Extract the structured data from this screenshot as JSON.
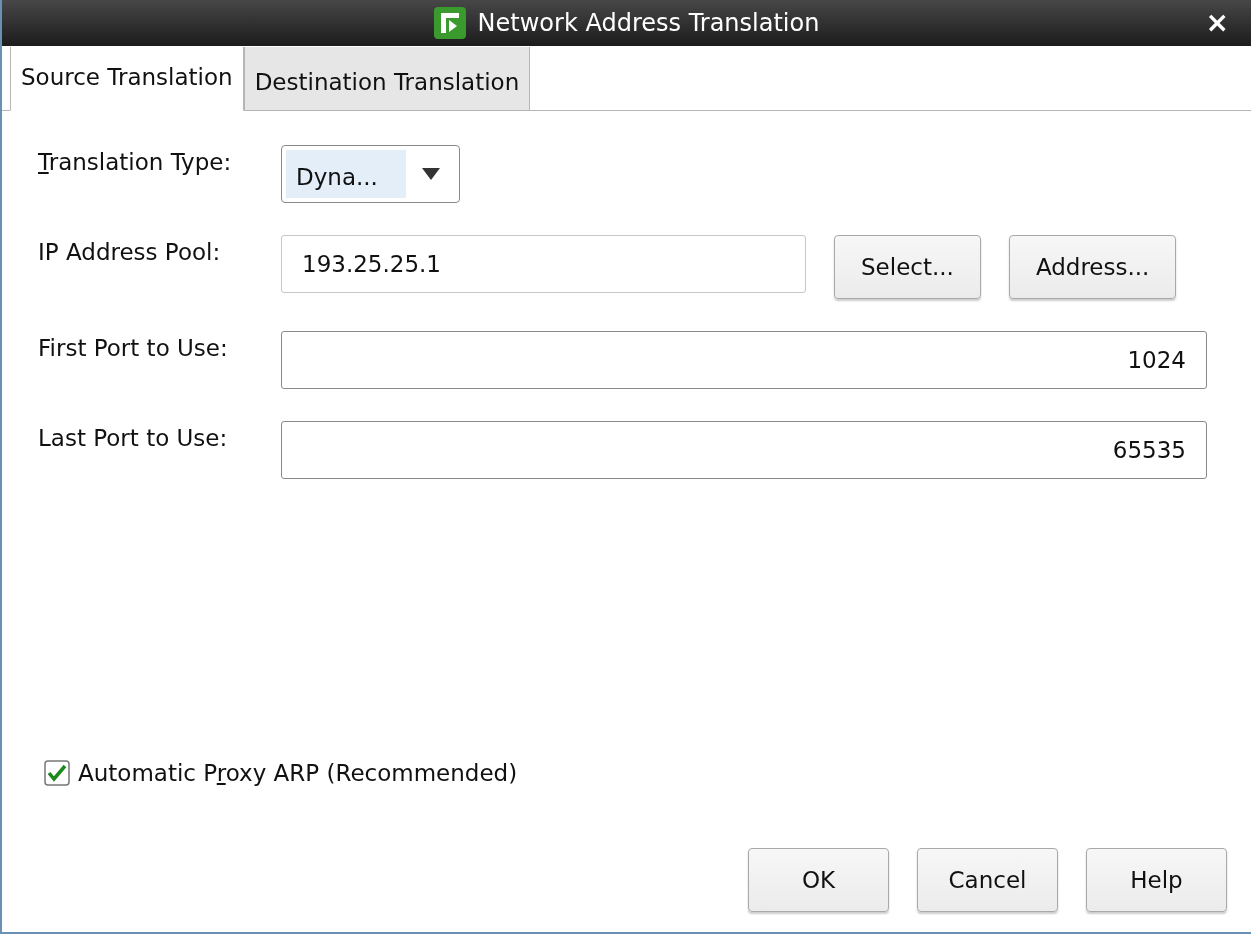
{
  "window": {
    "title": "Network Address Translation",
    "close": "×"
  },
  "tabs": [
    {
      "label": "Source Translation",
      "selected": true
    },
    {
      "label": "Destination Translation",
      "selected": false
    }
  ],
  "fields": [
    {
      "kind": "dropdown",
      "label_parts": [
        {
          "text": "T",
          "underlined": true
        },
        {
          "text": "ranslation Type:",
          "underlined": false
        }
      ],
      "value": "Dyna..."
    },
    {
      "kind": "text-with-buttons",
      "label_parts": [
        {
          "text": "IP Address Pool:",
          "underlined": false
        }
      ],
      "value": "193.25.25.1",
      "buttons": [
        "Select...",
        "Address..."
      ]
    },
    {
      "kind": "number",
      "label_parts": [
        {
          "text": "First Port to Use:",
          "underlined": false
        }
      ],
      "value": "1024"
    },
    {
      "kind": "number",
      "label_parts": [
        {
          "text": "Last Port to Use:",
          "underlined": false
        }
      ],
      "value": "65535"
    }
  ],
  "checkbox": {
    "checked": true,
    "label_parts": [
      {
        "text": "Automatic P",
        "underlined": false
      },
      {
        "text": "r",
        "underlined": true
      },
      {
        "text": "oxy ARP (Recommended)",
        "underlined": false
      }
    ]
  },
  "buttons": [
    "OK",
    "Cancel",
    "Help"
  ]
}
